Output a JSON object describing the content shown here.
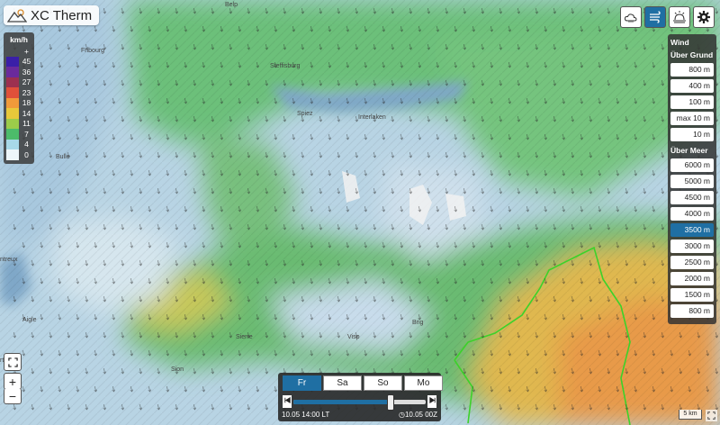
{
  "app": {
    "title": "XC Therm",
    "logo_icon": "mountain-sun-icon"
  },
  "legend": {
    "unit": "km/h",
    "top_marker": "+",
    "items": [
      {
        "label": "45",
        "color": "#3a1fa8"
      },
      {
        "label": "36",
        "color": "#6a2a9c"
      },
      {
        "label": "27",
        "color": "#9c3050"
      },
      {
        "label": "23",
        "color": "#e0503a"
      },
      {
        "label": "18",
        "color": "#f09a3a"
      },
      {
        "label": "14",
        "color": "#e8c83a"
      },
      {
        "label": "11",
        "color": "#9ccc4a"
      },
      {
        "label": "7",
        "color": "#4cbc6a"
      },
      {
        "label": "4",
        "color": "#a8d8e8"
      },
      {
        "label": "0",
        "color": "#eef6fa"
      }
    ]
  },
  "toolbar": {
    "buttons": [
      {
        "icon": "cloud-sun-icon",
        "active": false
      },
      {
        "icon": "wind-icon",
        "active": true
      },
      {
        "icon": "sun-horizon-icon",
        "active": false
      },
      {
        "icon": "gear-icon",
        "active": false
      }
    ]
  },
  "levels": {
    "title": "Wind",
    "agl_header": "Über Grund",
    "agl": [
      "800 m",
      "400 m",
      "100 m",
      "max 10 m",
      "10 m"
    ],
    "msl_header": "Über Meer",
    "msl": [
      "6000 m",
      "5000 m",
      "4500 m",
      "4000 m",
      "3500 m",
      "3000 m",
      "2500 m",
      "2000 m",
      "1500 m",
      "800 m"
    ],
    "selected": "3500 m"
  },
  "map": {
    "places": [
      "Belp",
      "Fribourg",
      "Steffisburg",
      "Spiez",
      "Interlaken",
      "Bulle",
      "ntreux",
      "Aigle",
      "Sierre",
      "Brig",
      "Visp",
      "Sion",
      "rthey"
    ],
    "scale": "5 km"
  },
  "controls": {
    "fullscreen_icon": "expand-icon",
    "zoom_in": "+",
    "zoom_out": "−",
    "fullscreen_right_icon": "expand-icon"
  },
  "time": {
    "days": [
      "Fr",
      "Sa",
      "So",
      "Mo"
    ],
    "active_day": "Fr",
    "position": 0.73,
    "prev_icon": "skip-back-icon",
    "next_icon": "skip-forward-icon",
    "local_time": "10.05 14:00 LT",
    "utc_time": "10.05 00Z",
    "utc_icon": "clock-icon"
  },
  "colors": {
    "accent": "#1f6fa3"
  }
}
